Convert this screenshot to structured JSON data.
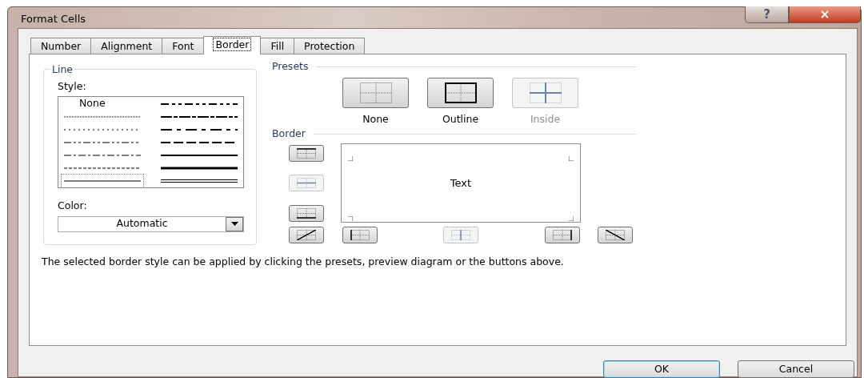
{
  "window": {
    "title": "Format Cells"
  },
  "title_buttons": [
    {
      "kind": "help",
      "label": "?"
    },
    {
      "kind": "close",
      "label": "×"
    }
  ],
  "tabs": [
    {
      "label": "Number",
      "selected": false
    },
    {
      "label": "Alignment",
      "selected": false
    },
    {
      "label": "Font",
      "selected": false
    },
    {
      "label": "Border",
      "selected": true
    },
    {
      "label": "Fill",
      "selected": false
    },
    {
      "label": "Protection",
      "selected": false
    }
  ],
  "line_group": {
    "title": "Line",
    "style_label": "Style:",
    "color_label": "Color:",
    "color_value": "Automatic"
  },
  "line_styles": [
    {
      "kind": "none",
      "label": "None",
      "selected": false
    },
    {
      "kind": "hair",
      "selected": false
    },
    {
      "kind": "dotted",
      "selected": false
    },
    {
      "kind": "dash-dot-dot",
      "selected": false
    },
    {
      "kind": "dash-dot",
      "selected": false
    },
    {
      "kind": "dashed",
      "selected": false
    },
    {
      "kind": "thin",
      "selected": true
    },
    {
      "kind": "medium-dash-dot-dot",
      "selected": false
    },
    {
      "kind": "slant-dash-dot",
      "selected": false
    },
    {
      "kind": "medium-dash-dot",
      "selected": false
    },
    {
      "kind": "medium-dashed",
      "selected": false
    },
    {
      "kind": "medium",
      "selected": false
    },
    {
      "kind": "thick",
      "selected": false
    },
    {
      "kind": "double",
      "selected": false
    }
  ],
  "presets": {
    "title": "Presets",
    "items": [
      {
        "kind": "none",
        "label": "None",
        "disabled": false
      },
      {
        "kind": "outline",
        "label": "Outline",
        "disabled": false
      },
      {
        "kind": "inside",
        "label": "Inside",
        "disabled": true
      }
    ]
  },
  "border": {
    "title": "Border",
    "preview_text": "Text",
    "buttons": [
      {
        "kind": "top",
        "disabled": false
      },
      {
        "kind": "middle-horizontal",
        "disabled": true
      },
      {
        "kind": "bottom",
        "disabled": false
      },
      {
        "kind": "diagonal-up",
        "disabled": false
      },
      {
        "kind": "left",
        "disabled": false
      },
      {
        "kind": "middle-vertical",
        "disabled": true
      },
      {
        "kind": "right",
        "disabled": false
      },
      {
        "kind": "diagonal-down",
        "disabled": false
      }
    ]
  },
  "hint": "The selected border style can be applied by clicking the presets, preview diagram or the buttons above.",
  "buttons": [
    {
      "label": "OK",
      "default": true
    },
    {
      "label": "Cancel",
      "default": false
    }
  ]
}
